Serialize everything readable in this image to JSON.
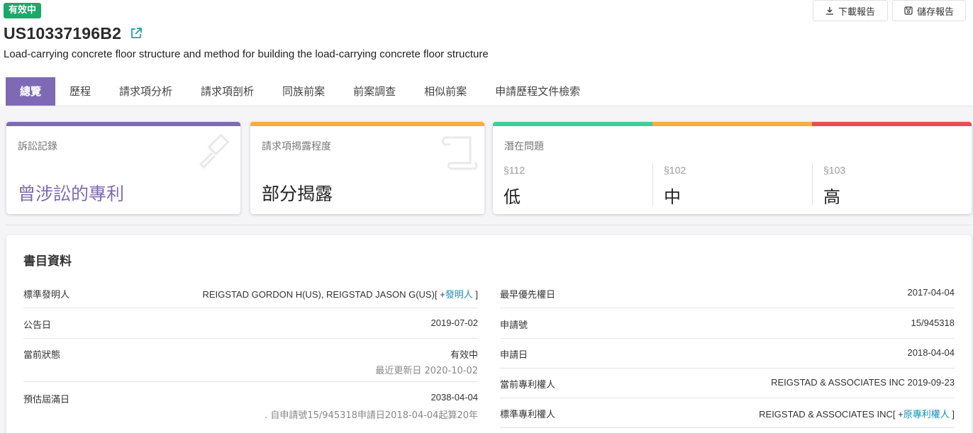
{
  "header": {
    "status_tag": "有效中",
    "patent_number": "US10337196B2",
    "title": "Load-carrying concrete floor structure and method for building the load-carrying concrete floor structure",
    "download_label": "下載報告",
    "save_label": "儲存報告"
  },
  "tabs": [
    {
      "label": "總覽",
      "active": true
    },
    {
      "label": "歷程"
    },
    {
      "label": "請求項分析"
    },
    {
      "label": "請求項剖析"
    },
    {
      "label": "同族前案"
    },
    {
      "label": "前案調查"
    },
    {
      "label": "相似前案"
    },
    {
      "label": "申請歷程文件檢索"
    }
  ],
  "cards": {
    "litigation": {
      "label": "訴訟記錄",
      "value": "曾涉訟的專利",
      "color": "#7e6ab4"
    },
    "disclosure": {
      "label": "請求項揭露程度",
      "value": "部分揭露",
      "color": "#f8ad3c"
    },
    "issues": {
      "label": "潛在問題",
      "bar_colors": [
        "#3ccf9a",
        "#f8ad3c",
        "#ef4a4f"
      ],
      "items": [
        {
          "section": "§112",
          "level": "低"
        },
        {
          "section": "§102",
          "level": "中"
        },
        {
          "section": "§103",
          "level": "高"
        }
      ]
    }
  },
  "biblio": {
    "title": "書目資料",
    "left": [
      {
        "label": "標準發明人",
        "value": "REIGSTAD GORDON H(US), REIGSTAD JASON G(US)[ +",
        "link": "發明人",
        "suffix": " ]"
      },
      {
        "label": "公告日",
        "value": "2019-07-02"
      },
      {
        "label": "當前狀態",
        "value": "有效中",
        "sub": "最近更新日 2020-10-02"
      },
      {
        "label": "預估屆滿日",
        "value": "2038-04-04",
        "sub": ". 自申請號15/945318申請日2018-04-04起算20年"
      }
    ],
    "right": [
      {
        "label": "最早優先權日",
        "value": "2017-04-04"
      },
      {
        "label": "申請號",
        "value": "15/945318"
      },
      {
        "label": "申請日",
        "value": "2018-04-04"
      },
      {
        "label": "當前專利權人",
        "value": "REIGSTAD & ASSOCIATES INC 2019-09-23"
      },
      {
        "label": "標準專利權人",
        "value": "REIGSTAD & ASSOCIATES INC[ +",
        "link": "原專利權人",
        "suffix": " ]"
      }
    ]
  }
}
